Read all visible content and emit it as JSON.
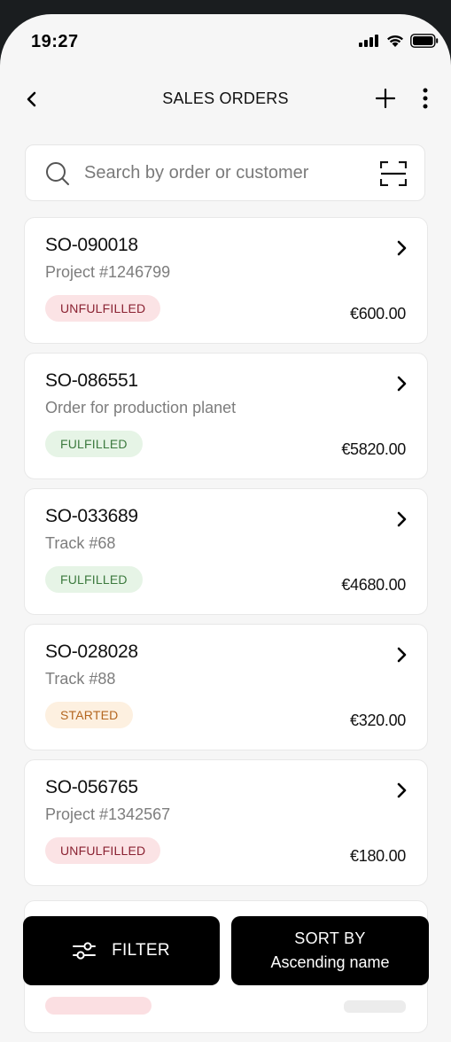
{
  "status_bar": {
    "time": "19:27"
  },
  "header": {
    "title": "SALES ORDERS",
    "back_icon": "chevron-left-icon",
    "add_icon": "plus-icon",
    "more_icon": "vertical-dots-icon"
  },
  "search": {
    "placeholder": "Search by order or customer",
    "value": "",
    "scan_icon": "scan-frame-icon"
  },
  "orders": [
    {
      "id": "SO-090018",
      "description": "Project #1246799",
      "status": "UNFULFILLED",
      "amount": "€600.00"
    },
    {
      "id": "SO-086551",
      "description": "Order for production planet",
      "status": "FULFILLED",
      "amount": "€5820.00"
    },
    {
      "id": "SO-033689",
      "description": "Track #68",
      "status": "FULFILLED",
      "amount": "€4680.00"
    },
    {
      "id": "SO-028028",
      "description": "Track #88",
      "status": "STARTED",
      "amount": "€320.00"
    },
    {
      "id": "SO-056765",
      "description": "Project #1342567",
      "status": "UNFULFILLED",
      "amount": "€180.00"
    }
  ],
  "bottom_actions": {
    "filter_label": "FILTER",
    "filter_icon": "sliders-icon",
    "sort_label": "SORT BY",
    "sort_value": "Ascending name"
  },
  "colors": {
    "unfulfilled_bg": "#fbe3e5",
    "unfulfilled_text": "#8a2232",
    "fulfilled_bg": "#e6f4e6",
    "fulfilled_text": "#3c7a3e",
    "started_bg": "#fdf0e0",
    "started_text": "#b4661f",
    "button_bg": "#000000"
  }
}
